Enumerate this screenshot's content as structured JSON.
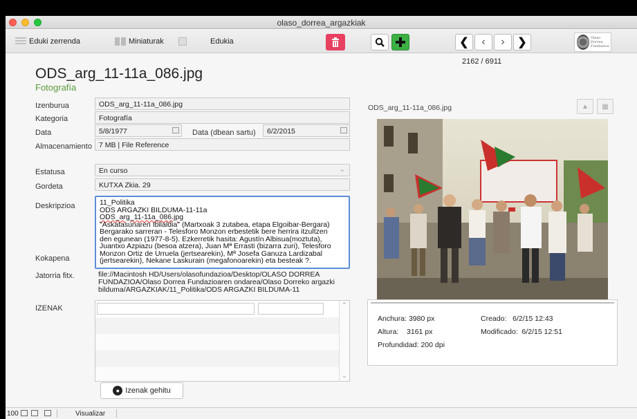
{
  "window": {
    "title": "olaso_dorrea_argazkiak"
  },
  "toolbar": {
    "tab_list": "Eduki zerrenda",
    "tab_thumbs": "Miniaturak",
    "tab_content": "Edukia",
    "trash_icon": "trash-icon",
    "search_icon": "search-icon",
    "add_icon": "plus-icon",
    "nav": [
      "first",
      "prev",
      "next",
      "last"
    ],
    "logo_text": [
      "Olaso",
      "Dorrea",
      "Fundazioa"
    ]
  },
  "record": {
    "counter": "2162 / 6911",
    "filename": "ODS_arg_11-11a_086.jpg",
    "category": "Fotografía"
  },
  "form": {
    "izenburua_label": "Izenburua",
    "izenburua_value": "ODS_arg_11-11a_086.jpg",
    "kategoria_label": "Kategoria",
    "kategoria_value": "Fotografía",
    "data_label": "Data",
    "data_value": "5/8/1977",
    "data_sartu_label": "Data (dbean sartu)",
    "data_sartu_value": "6/2/2015",
    "almacenamiento_label": "Almacenamiento",
    "almacenamiento_value": "7 MB | File Reference",
    "estatusa_label": "Estatusa",
    "estatusa_value": "En curso",
    "gordeta_label": "Gordeta",
    "gordeta_value": "KUTXA Zkia. 29",
    "deskripzioa_label": "Deskripzioa",
    "deskripzioa_lines": [
      "11_Politika",
      "ODS ARGAZKI BILDUMA-11-11a",
      "ODS_arg_11-11a_086.jpg",
      "\"Askatasunaren Ibilaldia\" (Martxoak 3 zutabea, etapa Elgoibar-Bergara)",
      "Bergarako sarreran - Telesforo Monzon erbestetik  bere herrira itzultzen",
      "den egunean (1977-8-5). Ezkerretik hasita: Agustín Albisua(moztuta),",
      "Juantxo Azpiazu (besoa atzera), Juan Mª Errasti (bizarra zuri), Telesforo",
      "Monzon Ortiz de Urruela (jertsearekin), Mª Josefa Ganuza Lardizabal",
      "(jertsearekin), Nekane Laskurain (megafonoarekin) eta besteak ?."
    ],
    "kokapena_label": "Kokapena",
    "jatorria_label": "Jatorria fitx.",
    "jatorria_lines": [
      "file://Macintosh HD/Users/olasofundazioa/Desktop/OLASO DORREA",
      "FUNDAZIOA/Olaso Dorrea Fundazioaren ondarea/Olaso Dorreko argazki",
      "bilduma/ARGAZKIAK/11_Politika/ODS ARGAZKI BILDUMA-11"
    ],
    "izenak_label": "IZENAK",
    "izenak_add": "Izenak gehitu"
  },
  "image_panel": {
    "caption": "ODS_arg_11-11a_086.jpg",
    "anchura_label": "Anchura:",
    "anchura_value": "3980 px",
    "altura_label": "Altura:",
    "altura_value": "3161 px",
    "profundidad": "Profundidad: 200 dpi",
    "creado_label": "Creado:",
    "creado_value": "6/2/15 12:43",
    "modificado_label": "Modificado:",
    "modificado_value": "6/2/15 12:51"
  },
  "status": {
    "zoom": "100",
    "mode": "Visualizar"
  }
}
